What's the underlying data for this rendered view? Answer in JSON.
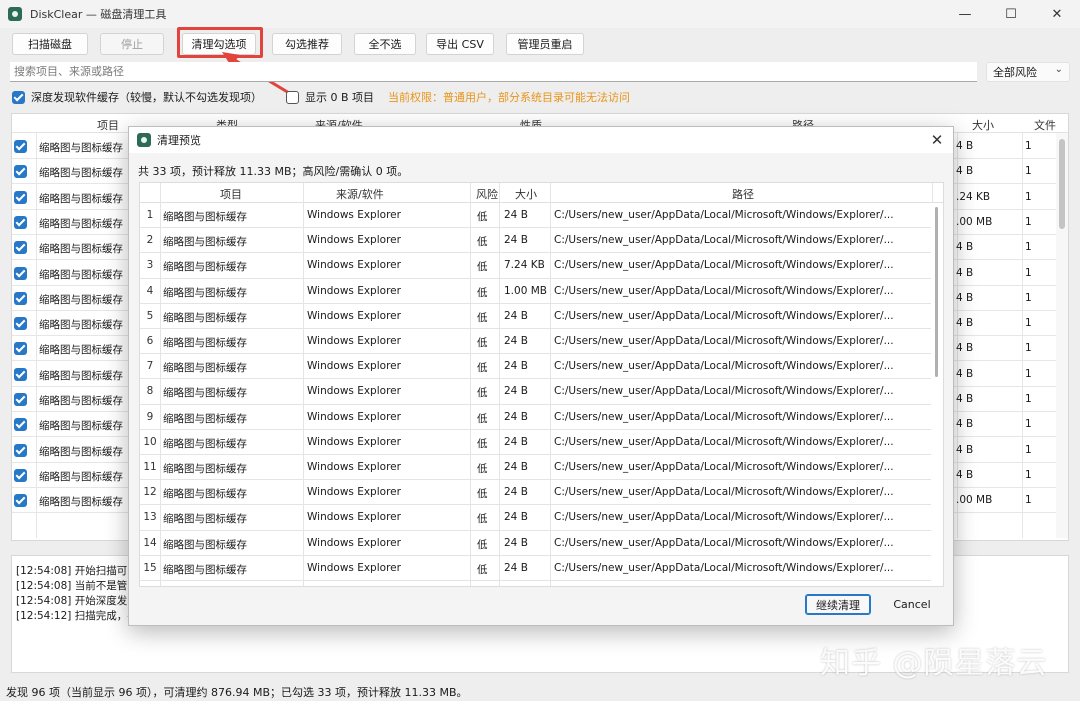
{
  "window": {
    "title": "DiskClear — 磁盘清理工具",
    "controls": [
      "—",
      "☐",
      "✕"
    ]
  },
  "toolbar": {
    "scan": "扫描磁盘",
    "stop": "停止",
    "clean_selected": "清理勾选项",
    "select_recommended": "勾选推荐",
    "deselect_all": "全不选",
    "export_csv": "导出 CSV",
    "admin_restart": "管理员重启"
  },
  "search": {
    "placeholder": "搜索项目、来源或路径"
  },
  "risk_filter": {
    "selected": "全部风险"
  },
  "options": {
    "deep_scan": "深度发现软件缓存（较慢，默认不勾选发现项）",
    "show_zero": "显示 0 B 项目",
    "permission": "当前权限：普通用户，部分系统目录可能无法访问"
  },
  "main_grid": {
    "headers": [
      "项目",
      "类型",
      "来源/软件",
      "性质",
      "路径",
      "大小",
      "文件"
    ],
    "rows": [
      {
        "name": "缩略图与图标缓存",
        "size": "4 B",
        "files": "1"
      },
      {
        "name": "缩略图与图标缓存",
        "size": "4 B",
        "files": "1"
      },
      {
        "name": "缩略图与图标缓存",
        "size": ".24 KB",
        "files": "1"
      },
      {
        "name": "缩略图与图标缓存",
        "size": ".00 MB",
        "files": "1"
      },
      {
        "name": "缩略图与图标缓存",
        "size": "4 B",
        "files": "1"
      },
      {
        "name": "缩略图与图标缓存",
        "size": "4 B",
        "files": "1"
      },
      {
        "name": "缩略图与图标缓存",
        "size": "4 B",
        "files": "1"
      },
      {
        "name": "缩略图与图标缓存",
        "size": "4 B",
        "files": "1"
      },
      {
        "name": "缩略图与图标缓存",
        "size": "4 B",
        "files": "1"
      },
      {
        "name": "缩略图与图标缓存",
        "size": "4 B",
        "files": "1"
      },
      {
        "name": "缩略图与图标缓存",
        "size": "4 B",
        "files": "1"
      },
      {
        "name": "缩略图与图标缓存",
        "size": "4 B",
        "files": "1"
      },
      {
        "name": "缩略图与图标缓存",
        "size": "4 B",
        "files": "1"
      },
      {
        "name": "缩略图与图标缓存",
        "size": "4 B",
        "files": "1"
      },
      {
        "name": "缩略图与图标缓存",
        "size": ".00 MB",
        "files": "1"
      }
    ]
  },
  "log": [
    "[12:54:08] 开始扫描可",
    "[12:54:08] 当前不是管",
    "[12:54:08] 开始深度发",
    "[12:54:12] 扫描完成，共"
  ],
  "status": "发现 96 项（当前显示 96 项），可清理约 876.94 MB；已勾选 33 项，预计释放 11.33 MB。",
  "watermark": "知乎 @陨星落云",
  "dialog": {
    "title": "清理预览",
    "summary": "共 33 项，预计释放 11.33 MB；高风险/需确认 0 项。",
    "headers": [
      "项目",
      "来源/软件",
      "风险",
      "大小",
      "路径"
    ],
    "rows": [
      {
        "idx": "1",
        "item": "缩略图与图标缓存",
        "source": "Windows Explorer",
        "risk": "低",
        "size": "24 B",
        "path": "C:/Users/new_user/AppData/Local/Microsoft/Windows/Explorer/..."
      },
      {
        "idx": "2",
        "item": "缩略图与图标缓存",
        "source": "Windows Explorer",
        "risk": "低",
        "size": "24 B",
        "path": "C:/Users/new_user/AppData/Local/Microsoft/Windows/Explorer/..."
      },
      {
        "idx": "3",
        "item": "缩略图与图标缓存",
        "source": "Windows Explorer",
        "risk": "低",
        "size": "7.24 KB",
        "path": "C:/Users/new_user/AppData/Local/Microsoft/Windows/Explorer/..."
      },
      {
        "idx": "4",
        "item": "缩略图与图标缓存",
        "source": "Windows Explorer",
        "risk": "低",
        "size": "1.00 MB",
        "path": "C:/Users/new_user/AppData/Local/Microsoft/Windows/Explorer/..."
      },
      {
        "idx": "5",
        "item": "缩略图与图标缓存",
        "source": "Windows Explorer",
        "risk": "低",
        "size": "24 B",
        "path": "C:/Users/new_user/AppData/Local/Microsoft/Windows/Explorer/..."
      },
      {
        "idx": "6",
        "item": "缩略图与图标缓存",
        "source": "Windows Explorer",
        "risk": "低",
        "size": "24 B",
        "path": "C:/Users/new_user/AppData/Local/Microsoft/Windows/Explorer/..."
      },
      {
        "idx": "7",
        "item": "缩略图与图标缓存",
        "source": "Windows Explorer",
        "risk": "低",
        "size": "24 B",
        "path": "C:/Users/new_user/AppData/Local/Microsoft/Windows/Explorer/..."
      },
      {
        "idx": "8",
        "item": "缩略图与图标缓存",
        "source": "Windows Explorer",
        "risk": "低",
        "size": "24 B",
        "path": "C:/Users/new_user/AppData/Local/Microsoft/Windows/Explorer/..."
      },
      {
        "idx": "9",
        "item": "缩略图与图标缓存",
        "source": "Windows Explorer",
        "risk": "低",
        "size": "24 B",
        "path": "C:/Users/new_user/AppData/Local/Microsoft/Windows/Explorer/..."
      },
      {
        "idx": "10",
        "item": "缩略图与图标缓存",
        "source": "Windows Explorer",
        "risk": "低",
        "size": "24 B",
        "path": "C:/Users/new_user/AppData/Local/Microsoft/Windows/Explorer/..."
      },
      {
        "idx": "11",
        "item": "缩略图与图标缓存",
        "source": "Windows Explorer",
        "risk": "低",
        "size": "24 B",
        "path": "C:/Users/new_user/AppData/Local/Microsoft/Windows/Explorer/..."
      },
      {
        "idx": "12",
        "item": "缩略图与图标缓存",
        "source": "Windows Explorer",
        "risk": "低",
        "size": "24 B",
        "path": "C:/Users/new_user/AppData/Local/Microsoft/Windows/Explorer/..."
      },
      {
        "idx": "13",
        "item": "缩略图与图标缓存",
        "source": "Windows Explorer",
        "risk": "低",
        "size": "24 B",
        "path": "C:/Users/new_user/AppData/Local/Microsoft/Windows/Explorer/..."
      },
      {
        "idx": "14",
        "item": "缩略图与图标缓存",
        "source": "Windows Explorer",
        "risk": "低",
        "size": "24 B",
        "path": "C:/Users/new_user/AppData/Local/Microsoft/Windows/Explorer/..."
      },
      {
        "idx": "15",
        "item": "缩略图与图标缓存",
        "source": "Windows Explorer",
        "risk": "低",
        "size": "24 B",
        "path": "C:/Users/new_user/AppData/Local/Microsoft/Windows/Explorer/..."
      }
    ],
    "continue_label": "继续清理",
    "cancel_label": "Cancel"
  },
  "colors": {
    "accent": "#2878c8",
    "highlight": "#e0443c",
    "warning_text": "#e8941a"
  },
  "icons": [
    "app-icon",
    "close-icon",
    "minimize-icon",
    "maximize-icon",
    "chevron-down-icon",
    "arrow-annotation"
  ]
}
